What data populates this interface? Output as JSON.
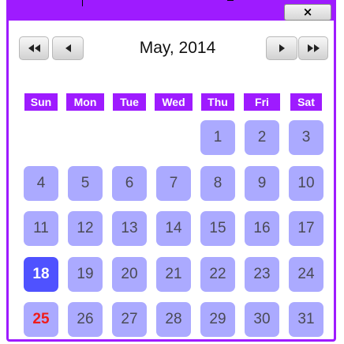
{
  "window": {
    "close_label": "×"
  },
  "nav": {
    "month_label": "May, 2014"
  },
  "weekdays": [
    "Sun",
    "Mon",
    "Tue",
    "Wed",
    "Thu",
    "Fri",
    "Sat"
  ],
  "days": [
    "",
    "",
    "",
    "",
    "1",
    "2",
    "3",
    "4",
    "5",
    "6",
    "7",
    "8",
    "9",
    "10",
    "11",
    "12",
    "13",
    "14",
    "15",
    "16",
    "17",
    "18",
    "19",
    "20",
    "21",
    "22",
    "23",
    "24",
    "25",
    "26",
    "27",
    "28",
    "29",
    "30",
    "31"
  ],
  "selected_day": "18",
  "highlighted_day": "25",
  "colors": {
    "accent": "#9e1bff",
    "day_cell": "#abaaff",
    "selected_cell": "#4f52ff",
    "highlight_text": "#f01b1b"
  }
}
